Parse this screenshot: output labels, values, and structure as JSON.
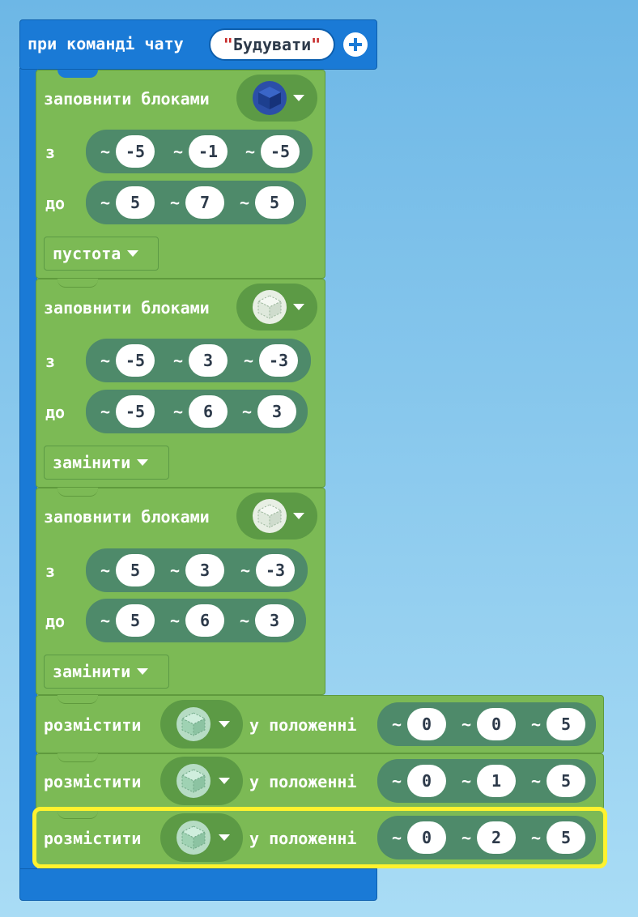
{
  "event": {
    "title": "при команді чату",
    "command": "Будувати",
    "quote_open": "\"",
    "quote_close": "\"",
    "add_icon": "plus-circle-icon"
  },
  "fill_blocks": [
    {
      "label": "заповнити блоками",
      "block_icon": "lapis-block-icon",
      "from_label": "з",
      "from": [
        "-5",
        "-1",
        "-5"
      ],
      "to_label": "до",
      "to": [
        "5",
        "7",
        "5"
      ],
      "mode": "пустота"
    },
    {
      "label": "заповнити блоками",
      "block_icon": "glass-block-icon",
      "from_label": "з",
      "from": [
        "-5",
        "3",
        "-3"
      ],
      "to_label": "до",
      "to": [
        "-5",
        "6",
        "3"
      ],
      "mode": "замінити"
    },
    {
      "label": "заповнити блоками",
      "block_icon": "glass-block-icon",
      "from_label": "з",
      "from": [
        "5",
        "3",
        "-3"
      ],
      "to_label": "до",
      "to": [
        "5",
        "6",
        "3"
      ],
      "mode": "замінити"
    }
  ],
  "place_blocks": [
    {
      "label": "розмістити",
      "block_icon": "green-glass-block-icon",
      "pos_label": "у положенні",
      "pos": [
        "0",
        "0",
        "5"
      ]
    },
    {
      "label": "розмістити",
      "block_icon": "green-glass-block-icon",
      "pos_label": "у положенні",
      "pos": [
        "0",
        "1",
        "5"
      ]
    },
    {
      "label": "розмістити",
      "block_icon": "green-glass-block-icon",
      "pos_label": "у положенні",
      "pos": [
        "0",
        "2",
        "5"
      ],
      "selected": true
    }
  ],
  "tilde": "~",
  "colors": {
    "event_blue": "#1a7ad6",
    "block_green": "#7cba55",
    "pill_green": "#5c9a45",
    "coord_green": "#4e8a6a",
    "highlight_yellow": "#fff22e"
  }
}
